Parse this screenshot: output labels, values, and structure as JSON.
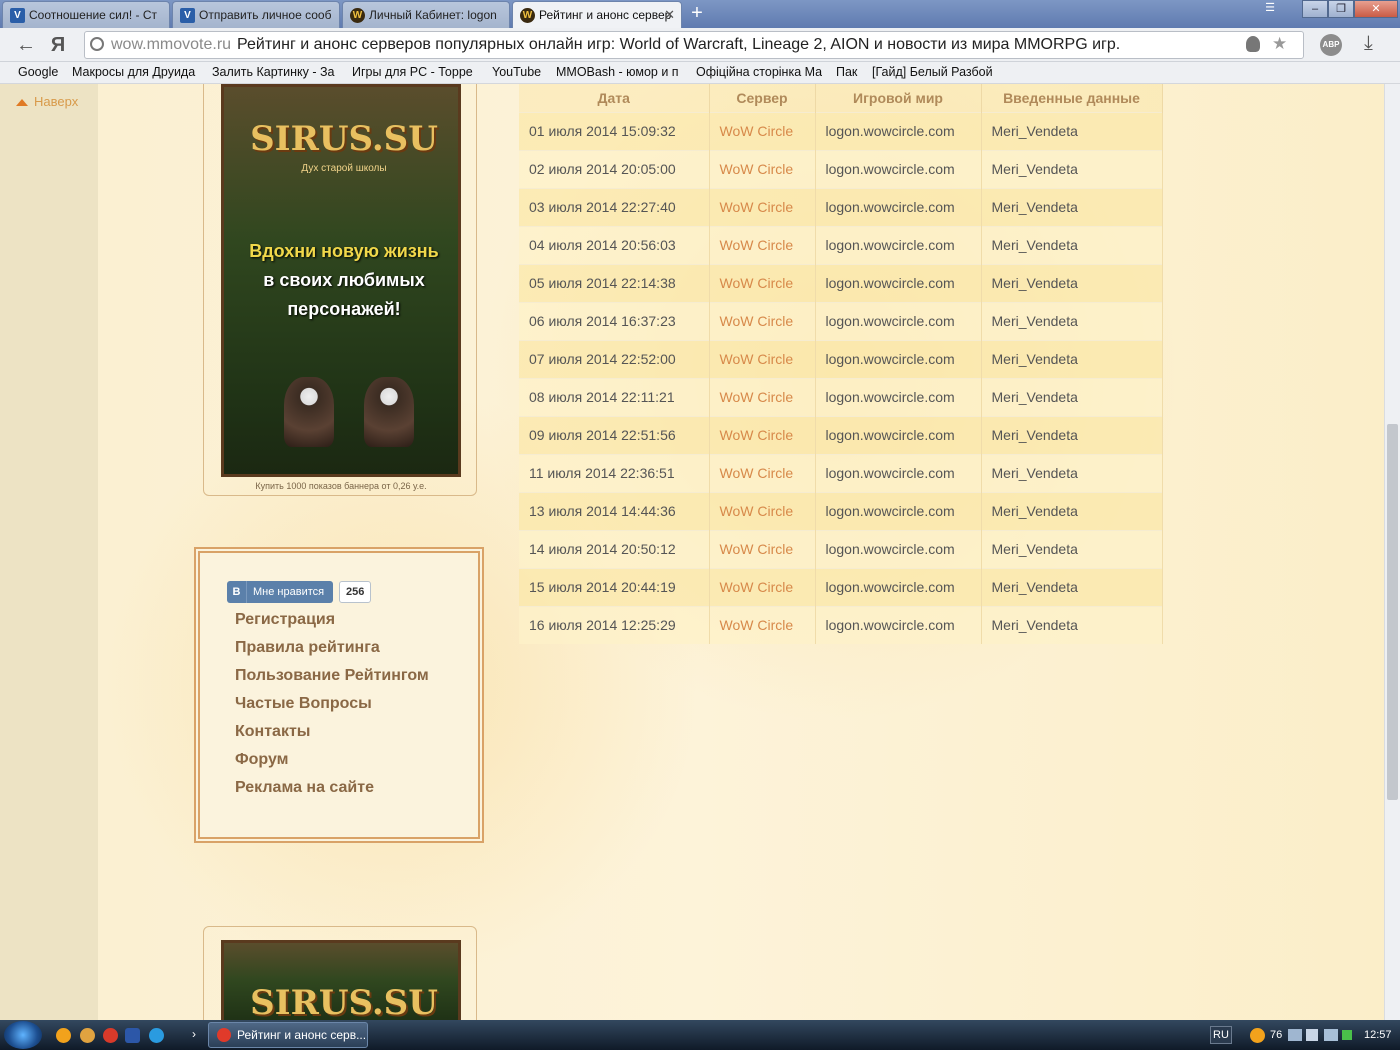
{
  "browser": {
    "tabs": [
      {
        "label": "Соотношение сил! - Ст",
        "favicon": "v-icon",
        "active": false
      },
      {
        "label": "Отправить личное сооб",
        "favicon": "v-icon",
        "active": false
      },
      {
        "label": "Личный Кабинет: logon",
        "favicon": "w-icon",
        "active": false
      },
      {
        "label": "Рейтинг и анонс сервер",
        "favicon": "w-icon",
        "active": true
      }
    ],
    "new_tab": "+",
    "url_domain": "wow.mmovote.ru",
    "url_title": "Рейтинг и анонс серверов популярных онлайн игр: World of Warcraft, Lineage 2, AION и новости из мира MMORPG игр.",
    "yandex_glyph": "Я",
    "abp": "ABP",
    "bookmarks": [
      "Google",
      "Макросы для Друида",
      "Залить Картинку - За",
      "Игры для PC - Торре",
      "YouTube",
      "MMOBash - юмор и п",
      "Офіційна сторінка Ма",
      "Пак",
      "[Гайд] Белый Разбой"
    ]
  },
  "page": {
    "back_to_top": "Наверх",
    "banner": {
      "logo": "SIRUS.SU",
      "logo_sub": "Дух старой школы",
      "slogan_line1": "Вдохни новую жизнь",
      "slogan_line2": "в своих любимых",
      "slogan_line3": "персонажей!"
    },
    "buy_text": "Купить 1000 показов баннера от 0,26 у.е.",
    "vk": {
      "letter": "В",
      "label": "Мне нравится",
      "count": "256"
    },
    "menu": [
      "Регистрация",
      "Правила рейтинга",
      "Пользование Рейтингом",
      "Частые Вопросы",
      "Контакты",
      "Форум",
      "Реклама на сайте"
    ],
    "table": {
      "headers": [
        "Дата",
        "Сервер",
        "Игровой мир",
        "Введенные данные"
      ],
      "rows": [
        [
          "01 июля 2014 15:09:32",
          "WoW Circle",
          "logon.wowcircle.com",
          "Meri_Vendeta"
        ],
        [
          "02 июля 2014 20:05:00",
          "WoW Circle",
          "logon.wowcircle.com",
          "Meri_Vendeta"
        ],
        [
          "03 июля 2014 22:27:40",
          "WoW Circle",
          "logon.wowcircle.com",
          "Meri_Vendeta"
        ],
        [
          "04 июля 2014 20:56:03",
          "WoW Circle",
          "logon.wowcircle.com",
          "Meri_Vendeta"
        ],
        [
          "05 июля 2014 22:14:38",
          "WoW Circle",
          "logon.wowcircle.com",
          "Meri_Vendeta"
        ],
        [
          "06 июля 2014 16:37:23",
          "WoW Circle",
          "logon.wowcircle.com",
          "Meri_Vendeta"
        ],
        [
          "07 июля 2014 22:52:00",
          "WoW Circle",
          "logon.wowcircle.com",
          "Meri_Vendeta"
        ],
        [
          "08 июля 2014 22:11:21",
          "WoW Circle",
          "logon.wowcircle.com",
          "Meri_Vendeta"
        ],
        [
          "09 июля 2014 22:51:56",
          "WoW Circle",
          "logon.wowcircle.com",
          "Meri_Vendeta"
        ],
        [
          "11 июля 2014 22:36:51",
          "WoW Circle",
          "logon.wowcircle.com",
          "Meri_Vendeta"
        ],
        [
          "13 июля 2014 14:44:36",
          "WoW Circle",
          "logon.wowcircle.com",
          "Meri_Vendeta"
        ],
        [
          "14 июля 2014 20:50:12",
          "WoW Circle",
          "logon.wowcircle.com",
          "Meri_Vendeta"
        ],
        [
          "15 июля 2014 20:44:19",
          "WoW Circle",
          "logon.wowcircle.com",
          "Meri_Vendeta"
        ],
        [
          "16 июля 2014 12:25:29",
          "WoW Circle",
          "logon.wowcircle.com",
          "Meri_Vendeta"
        ]
      ]
    }
  },
  "taskbar": {
    "task_label": "Рейтинг и анонс серв...",
    "lang": "RU",
    "tray_count": "76",
    "clock": "12:57"
  },
  "colors": {
    "accent": "#d7894a",
    "menu_text": "#8a6845",
    "vk_blue": "#5b80aa"
  }
}
